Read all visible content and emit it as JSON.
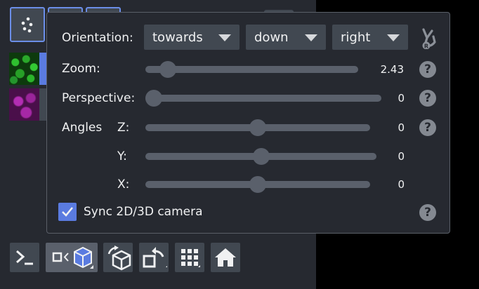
{
  "camera_popup": {
    "orientation": {
      "label": "Orientation:",
      "selects": [
        "towards",
        "down",
        "right"
      ]
    },
    "zoom": {
      "label": "Zoom:",
      "value": "2.43",
      "fraction": 0.07
    },
    "perspective": {
      "label": "Perspective:",
      "value": "0",
      "fraction": 0.0
    },
    "angles": {
      "label": "Angles",
      "z": {
        "label": "Z:",
        "value": "0",
        "fraction": 0.5
      },
      "y": {
        "label": "Y:",
        "value": "0",
        "fraction": 0.5
      },
      "x": {
        "label": "X:",
        "value": "0",
        "fraction": 0.5
      }
    },
    "sync": {
      "label": "Sync 2D/3D camera",
      "checked": true
    },
    "help_glyph": "?"
  },
  "colors": {
    "panel_bg": "#262930",
    "widget_bg": "#414851",
    "accent": "#5a7be0",
    "help_bg": "#848991"
  },
  "bottom_toolbar": [
    "console-icon",
    "ndisplay-toggle-icon",
    "roll-dims-icon",
    "transpose-icon",
    "grid-icon",
    "home-icon"
  ]
}
